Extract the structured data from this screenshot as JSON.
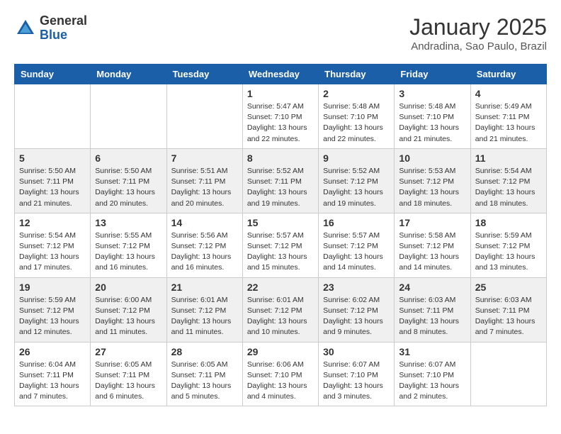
{
  "header": {
    "logo": {
      "general": "General",
      "blue": "Blue"
    },
    "title": "January 2025",
    "subtitle": "Andradina, Sao Paulo, Brazil"
  },
  "weekdays": [
    "Sunday",
    "Monday",
    "Tuesday",
    "Wednesday",
    "Thursday",
    "Friday",
    "Saturday"
  ],
  "weeks": [
    {
      "shaded": false,
      "days": [
        {
          "number": "",
          "info": "",
          "empty": true
        },
        {
          "number": "",
          "info": "",
          "empty": true
        },
        {
          "number": "",
          "info": "",
          "empty": true
        },
        {
          "number": "1",
          "info": "Sunrise: 5:47 AM\nSunset: 7:10 PM\nDaylight: 13 hours\nand 22 minutes.",
          "empty": false
        },
        {
          "number": "2",
          "info": "Sunrise: 5:48 AM\nSunset: 7:10 PM\nDaylight: 13 hours\nand 22 minutes.",
          "empty": false
        },
        {
          "number": "3",
          "info": "Sunrise: 5:48 AM\nSunset: 7:10 PM\nDaylight: 13 hours\nand 21 minutes.",
          "empty": false
        },
        {
          "number": "4",
          "info": "Sunrise: 5:49 AM\nSunset: 7:11 PM\nDaylight: 13 hours\nand 21 minutes.",
          "empty": false
        }
      ]
    },
    {
      "shaded": true,
      "days": [
        {
          "number": "5",
          "info": "Sunrise: 5:50 AM\nSunset: 7:11 PM\nDaylight: 13 hours\nand 21 minutes.",
          "empty": false
        },
        {
          "number": "6",
          "info": "Sunrise: 5:50 AM\nSunset: 7:11 PM\nDaylight: 13 hours\nand 20 minutes.",
          "empty": false
        },
        {
          "number": "7",
          "info": "Sunrise: 5:51 AM\nSunset: 7:11 PM\nDaylight: 13 hours\nand 20 minutes.",
          "empty": false
        },
        {
          "number": "8",
          "info": "Sunrise: 5:52 AM\nSunset: 7:11 PM\nDaylight: 13 hours\nand 19 minutes.",
          "empty": false
        },
        {
          "number": "9",
          "info": "Sunrise: 5:52 AM\nSunset: 7:12 PM\nDaylight: 13 hours\nand 19 minutes.",
          "empty": false
        },
        {
          "number": "10",
          "info": "Sunrise: 5:53 AM\nSunset: 7:12 PM\nDaylight: 13 hours\nand 18 minutes.",
          "empty": false
        },
        {
          "number": "11",
          "info": "Sunrise: 5:54 AM\nSunset: 7:12 PM\nDaylight: 13 hours\nand 18 minutes.",
          "empty": false
        }
      ]
    },
    {
      "shaded": false,
      "days": [
        {
          "number": "12",
          "info": "Sunrise: 5:54 AM\nSunset: 7:12 PM\nDaylight: 13 hours\nand 17 minutes.",
          "empty": false
        },
        {
          "number": "13",
          "info": "Sunrise: 5:55 AM\nSunset: 7:12 PM\nDaylight: 13 hours\nand 16 minutes.",
          "empty": false
        },
        {
          "number": "14",
          "info": "Sunrise: 5:56 AM\nSunset: 7:12 PM\nDaylight: 13 hours\nand 16 minutes.",
          "empty": false
        },
        {
          "number": "15",
          "info": "Sunrise: 5:57 AM\nSunset: 7:12 PM\nDaylight: 13 hours\nand 15 minutes.",
          "empty": false
        },
        {
          "number": "16",
          "info": "Sunrise: 5:57 AM\nSunset: 7:12 PM\nDaylight: 13 hours\nand 14 minutes.",
          "empty": false
        },
        {
          "number": "17",
          "info": "Sunrise: 5:58 AM\nSunset: 7:12 PM\nDaylight: 13 hours\nand 14 minutes.",
          "empty": false
        },
        {
          "number": "18",
          "info": "Sunrise: 5:59 AM\nSunset: 7:12 PM\nDaylight: 13 hours\nand 13 minutes.",
          "empty": false
        }
      ]
    },
    {
      "shaded": true,
      "days": [
        {
          "number": "19",
          "info": "Sunrise: 5:59 AM\nSunset: 7:12 PM\nDaylight: 13 hours\nand 12 minutes.",
          "empty": false
        },
        {
          "number": "20",
          "info": "Sunrise: 6:00 AM\nSunset: 7:12 PM\nDaylight: 13 hours\nand 11 minutes.",
          "empty": false
        },
        {
          "number": "21",
          "info": "Sunrise: 6:01 AM\nSunset: 7:12 PM\nDaylight: 13 hours\nand 11 minutes.",
          "empty": false
        },
        {
          "number": "22",
          "info": "Sunrise: 6:01 AM\nSunset: 7:12 PM\nDaylight: 13 hours\nand 10 minutes.",
          "empty": false
        },
        {
          "number": "23",
          "info": "Sunrise: 6:02 AM\nSunset: 7:12 PM\nDaylight: 13 hours\nand 9 minutes.",
          "empty": false
        },
        {
          "number": "24",
          "info": "Sunrise: 6:03 AM\nSunset: 7:11 PM\nDaylight: 13 hours\nand 8 minutes.",
          "empty": false
        },
        {
          "number": "25",
          "info": "Sunrise: 6:03 AM\nSunset: 7:11 PM\nDaylight: 13 hours\nand 7 minutes.",
          "empty": false
        }
      ]
    },
    {
      "shaded": false,
      "days": [
        {
          "number": "26",
          "info": "Sunrise: 6:04 AM\nSunset: 7:11 PM\nDaylight: 13 hours\nand 7 minutes.",
          "empty": false
        },
        {
          "number": "27",
          "info": "Sunrise: 6:05 AM\nSunset: 7:11 PM\nDaylight: 13 hours\nand 6 minutes.",
          "empty": false
        },
        {
          "number": "28",
          "info": "Sunrise: 6:05 AM\nSunset: 7:11 PM\nDaylight: 13 hours\nand 5 minutes.",
          "empty": false
        },
        {
          "number": "29",
          "info": "Sunrise: 6:06 AM\nSunset: 7:10 PM\nDaylight: 13 hours\nand 4 minutes.",
          "empty": false
        },
        {
          "number": "30",
          "info": "Sunrise: 6:07 AM\nSunset: 7:10 PM\nDaylight: 13 hours\nand 3 minutes.",
          "empty": false
        },
        {
          "number": "31",
          "info": "Sunrise: 6:07 AM\nSunset: 7:10 PM\nDaylight: 13 hours\nand 2 minutes.",
          "empty": false
        },
        {
          "number": "",
          "info": "",
          "empty": true
        }
      ]
    }
  ]
}
